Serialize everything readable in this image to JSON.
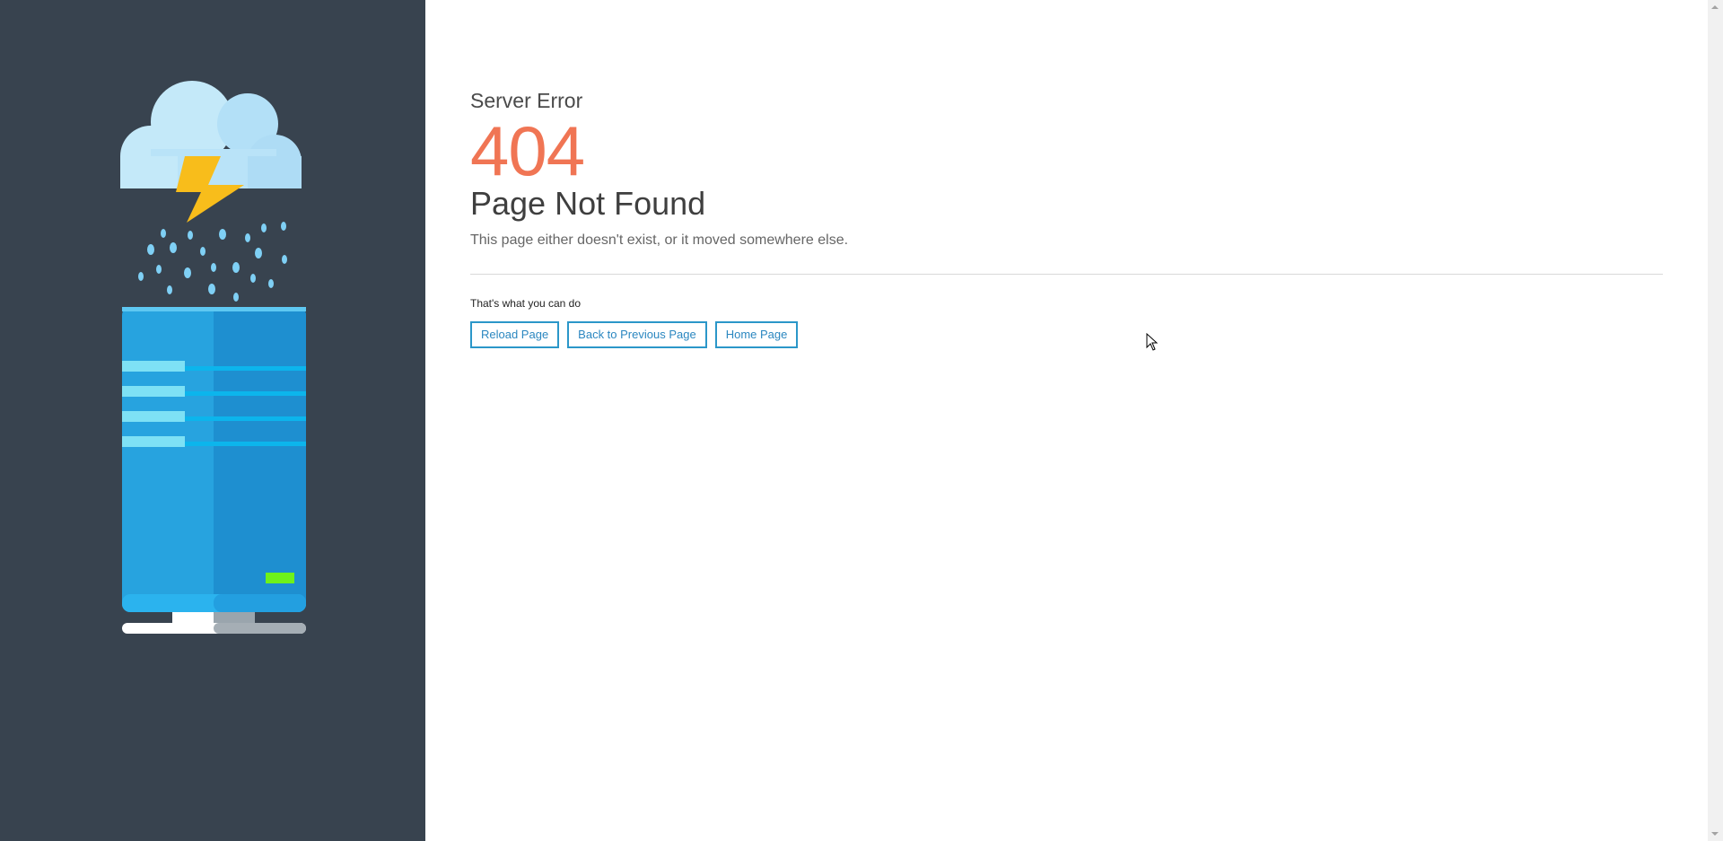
{
  "error": {
    "eyebrow": "Server Error",
    "code": "404",
    "headline": "Page Not Found",
    "description": "This page either doesn't exist, or it moved somewhere else."
  },
  "actions": {
    "heading": "That's what you can do",
    "reload_label": "Reload Page",
    "back_label": "Back to Previous Page",
    "home_label": "Home Page"
  },
  "colors": {
    "sidebar": "#38434f",
    "accent": "#f07554",
    "button_border": "#2b97c9"
  },
  "icons": {
    "illustration": "server-storm-illustration"
  }
}
